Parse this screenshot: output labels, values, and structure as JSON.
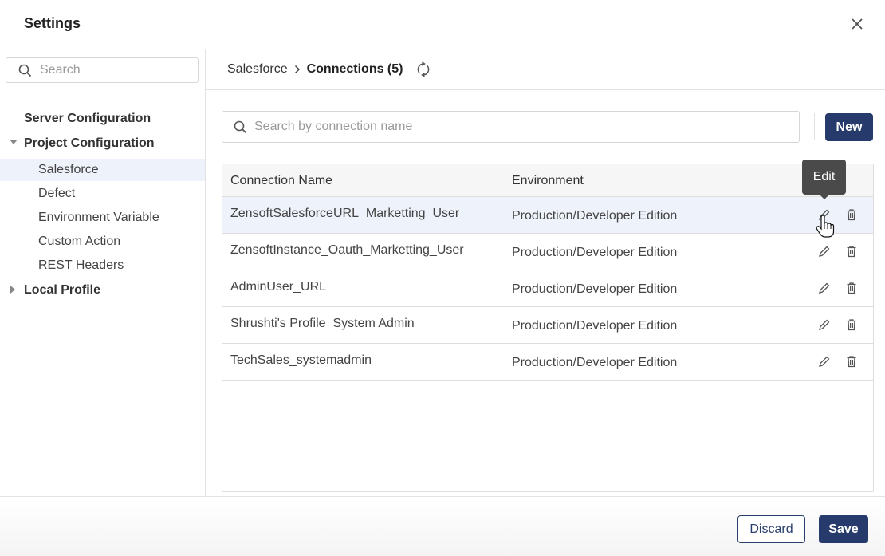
{
  "dialog": {
    "title": "Settings",
    "close_icon": "close-icon"
  },
  "sidebar": {
    "search_placeholder": "Search",
    "items": [
      {
        "label": "Server Configuration",
        "level": "group",
        "expandable": false
      },
      {
        "label": "Project Configuration",
        "level": "group",
        "expanded": true
      },
      {
        "label": "Salesforce",
        "level": "sub",
        "active": true
      },
      {
        "label": "Defect",
        "level": "sub"
      },
      {
        "label": "Environment Variable",
        "level": "sub"
      },
      {
        "label": "Custom Action",
        "level": "sub"
      },
      {
        "label": "REST Headers",
        "level": "sub"
      },
      {
        "label": "Local Profile",
        "level": "group",
        "expanded": false
      }
    ]
  },
  "breadcrumb": {
    "parent": "Salesforce",
    "current": "Connections (5)",
    "refresh_icon": "refresh-icon"
  },
  "connections": {
    "search_placeholder": "Search by connection name",
    "new_label": "New",
    "columns": [
      "Connection Name",
      "Environment"
    ],
    "rows": [
      {
        "name": "ZensoftSalesforceURL_Marketting_User",
        "environment": "Production/Developer Edition"
      },
      {
        "name": "ZensoftInstance_Oauth_Marketting_User",
        "environment": "Production/Developer Edition"
      },
      {
        "name": "AdminUser_URL",
        "environment": "Production/Developer Edition"
      },
      {
        "name": "Shrushti's Profile_System Admin",
        "environment": "Production/Developer Edition"
      },
      {
        "name": "TechSales_systemadmin",
        "environment": "Production/Developer Edition"
      }
    ],
    "tooltip": "Edit"
  },
  "footer": {
    "discard_label": "Discard",
    "save_label": "Save"
  },
  "colors": {
    "primary": "#263a6b",
    "active_bg": "#eef2fb",
    "tooltip_bg": "#4a4a4a"
  }
}
